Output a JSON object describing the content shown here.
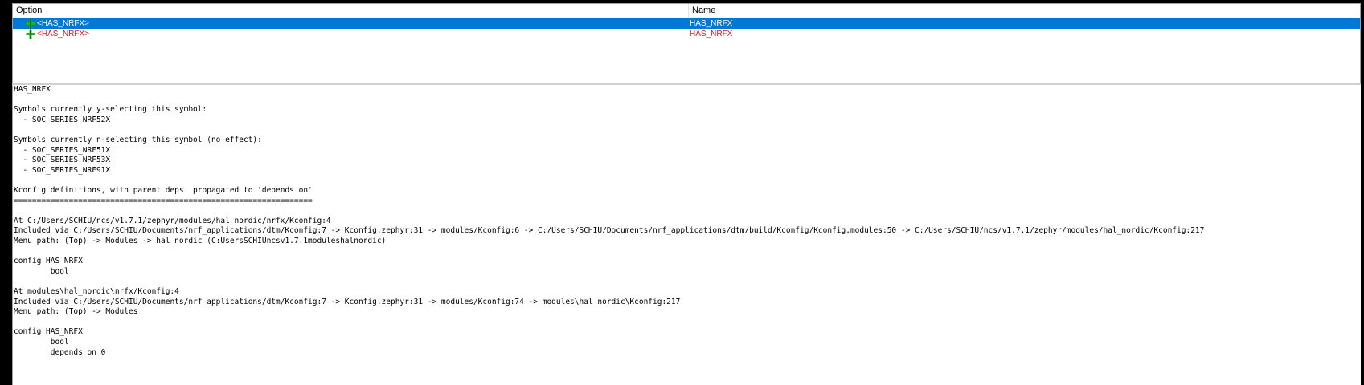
{
  "tree": {
    "columns": {
      "option": "Option",
      "name": "Name"
    },
    "rows": [
      {
        "option": "<HAS_NRFX>",
        "name": "HAS_NRFX",
        "icon": "green-plus-icon",
        "selected": true
      },
      {
        "option": "<HAS_NRFX>",
        "name": "HAS_NRFX",
        "icon": "green-plus-icon",
        "selected": false
      }
    ]
  },
  "colors": {
    "selection": "#0078d7",
    "red_text": "#e81123",
    "icon_green": "#1db51d"
  },
  "info": {
    "lines": [
      "HAS_NRFX",
      "",
      "Symbols currently y-selecting this symbol:",
      "  - SOC_SERIES_NRF52X",
      "",
      "Symbols currently n-selecting this symbol (no effect):",
      "  - SOC_SERIES_NRF51X",
      "  - SOC_SERIES_NRF53X",
      "  - SOC_SERIES_NRF91X",
      "",
      "Kconfig definitions, with parent deps. propagated to 'depends on'",
      "=================================================================",
      "",
      "At C:/Users/SCHIU/ncs/v1.7.1/zephyr/modules/hal_nordic/nrfx/Kconfig:4",
      "Included via C:/Users/SCHIU/Documents/nrf_applications/dtm/Kconfig:7 -> Kconfig.zephyr:31 -> modules/Kconfig:6 -> C:/Users/SCHIU/Documents/nrf_applications/dtm/build/Kconfig/Kconfig.modules:50 -> C:/Users/SCHIU/ncs/v1.7.1/zephyr/modules/hal_nordic/Kconfig:217",
      "Menu path: (Top) -> Modules -> hal_nordic (C:UsersSCHIUncsv1.7.1moduleshalnordic)",
      "",
      "config HAS_NRFX",
      "        bool",
      "",
      "At modules\\hal_nordic\\nrfx/Kconfig:4",
      "Included via C:/Users/SCHIU/Documents/nrf_applications/dtm/Kconfig:7 -> Kconfig.zephyr:31 -> modules/Kconfig:74 -> modules\\hal_nordic\\Kconfig:217",
      "Menu path: (Top) -> Modules",
      "",
      "config HAS_NRFX",
      "        bool",
      "        depends on 0"
    ]
  }
}
